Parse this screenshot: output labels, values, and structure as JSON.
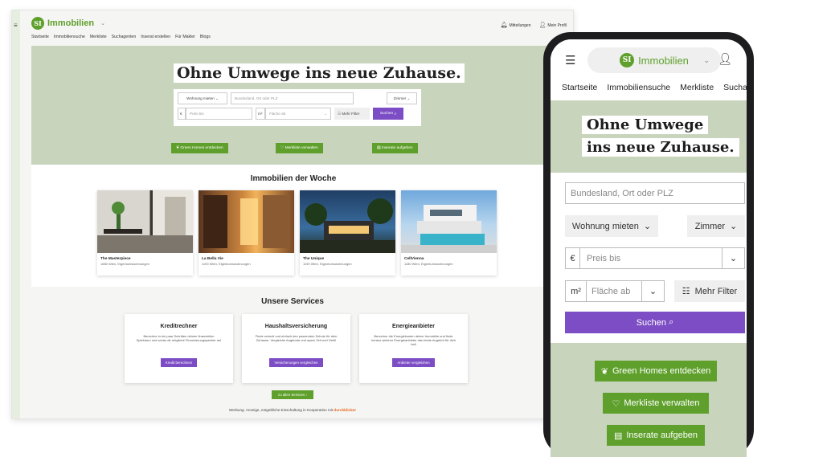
{
  "brand": {
    "name": "Immobilien",
    "badge": "SI",
    "color": "#5fa02c",
    "accent": "#7c4dc4"
  },
  "desktop": {
    "menu_icon": "≡",
    "nav": [
      "Startseite",
      "Immobiliensuche",
      "Merkliste",
      "Suchagenten",
      "Inserat erstellen",
      "Für Makler",
      "Blogs"
    ],
    "notifications": "Mitteilungen",
    "profile": "Mein Profil",
    "hero_title": "Ohne Umwege ins neue Zuhause.",
    "search": {
      "type_select": "Wohnung mieten",
      "location_placeholder": "Bundesland, Ort oder PLZ",
      "rooms_select": "Zimmer",
      "currency": "€",
      "price_placeholder": "Preis bis",
      "area_unit": "m²",
      "area_placeholder": "Fläche ab",
      "more_filters": "Mehr Filter",
      "submit": "Suchen"
    },
    "actions": [
      "Green Homes entdecken",
      "Merkliste verwalten",
      "Inserate aufgeben"
    ],
    "week_title": "Immobilien der Woche",
    "listings": [
      {
        "name": "The Masterpiece",
        "sub": "1680 Wien, Eigentumswohnungen"
      },
      {
        "name": "La Bella Vie",
        "sub": "1190 Wien, Eigentumswohnungen"
      },
      {
        "name": "The Unique",
        "sub": "1190 Wien, Eigentumswohnungen"
      },
      {
        "name": "CellVienna",
        "sub": "1180 Wien, Eigentumswohnungen"
      }
    ],
    "services_title": "Unsere Services",
    "services": [
      {
        "title": "Kreditrechner",
        "text": "Berechne in ein paar Schritten deinen finanziellen Spielraum und schau dir mögliche Finanzierungspartner an!",
        "button": "Kredit berechnen"
      },
      {
        "title": "Haushaltsversicherung",
        "text": "Finde schnell und einfach den passenden Schutz für dein Zuhause. Vergleiche Angebote und spare Zeit und Geld!",
        "button": "Versicherungen vergleichen"
      },
      {
        "title": "Energieanbieter",
        "text": "Berechne die Energiekosten deiner Immobilie und finde heraus welcher Energieanbieter das beste Angebot für dich hat!",
        "button": "Anbieter vergleichen"
      }
    ],
    "all_services": "zu allen Services",
    "footer_text": "Werbung. Anzeige, entgeltliche Einschaltung in Kooperation mit",
    "footer_brand": "durchblicker"
  },
  "mobile": {
    "nav": [
      "Startseite",
      "Immobiliensuche",
      "Merkliste",
      "Suchage"
    ],
    "hero_line1": "Ohne Umwege",
    "hero_line2": "ins neue Zuhause.",
    "location_placeholder": "Bundesland, Ort oder PLZ",
    "type_select": "Wohnung mieten",
    "rooms_select": "Zimmer",
    "currency": "€",
    "price_placeholder": "Preis bis",
    "area_unit": "m²",
    "area_placeholder": "Fläche ab",
    "more_filters": "Mehr Filter",
    "submit": "Suchen",
    "actions": [
      "Green Homes entdecken",
      "Merkliste verwalten",
      "Inserate aufgeben"
    ]
  }
}
